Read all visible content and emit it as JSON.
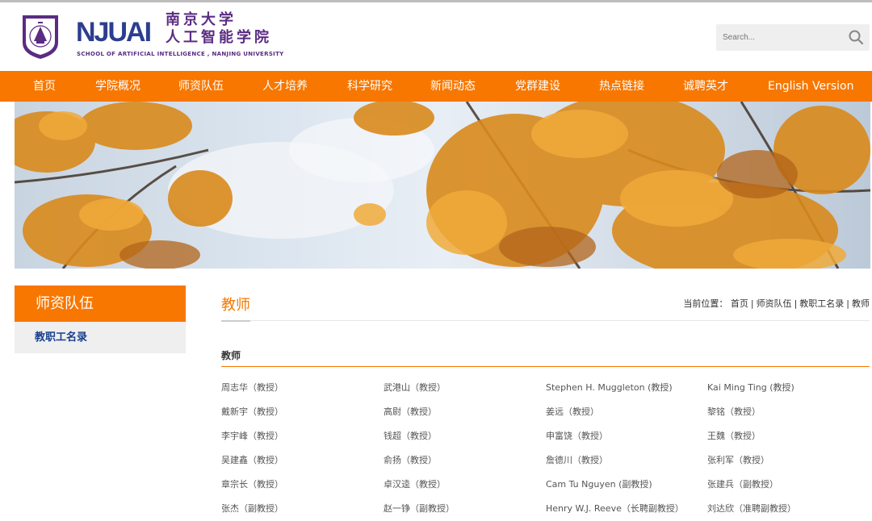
{
  "header": {
    "logo_latin": "NJUAI",
    "logo_cn_line1": "南京大学",
    "logo_cn_line2": "人工智能学院",
    "logo_en": "SCHOOL OF ARTIFICIAL INTELLIGENCE , NANJING UNIVERSITY",
    "search_placeholder": "Search..."
  },
  "nav": [
    {
      "label": "首页"
    },
    {
      "label": "学院概况"
    },
    {
      "label": "师资队伍"
    },
    {
      "label": "人才培养"
    },
    {
      "label": "科学研究"
    },
    {
      "label": "新闻动态"
    },
    {
      "label": "党群建设"
    },
    {
      "label": "热点链接"
    },
    {
      "label": "诚聘英才"
    },
    {
      "label": "English Version"
    }
  ],
  "sidebar": {
    "title": "师资队伍",
    "items": [
      {
        "label": "教职工名录"
      }
    ]
  },
  "main": {
    "title": "教师",
    "breadcrumb_prefix": "当前位置：",
    "breadcrumb": [
      "首页",
      "师资队伍",
      "教职工名录",
      "教师"
    ],
    "section_title": "教师",
    "faculty": [
      [
        "周志华（教授）",
        "武港山（教授）",
        "Stephen H. Muggleton (教授)",
        "Kai Ming Ting (教授)"
      ],
      [
        "戴新宇（教授）",
        "高尉（教授）",
        "姜远（教授）",
        "黎铭（教授）"
      ],
      [
        "李宇峰（教授）",
        "钱超（教授）",
        "申富饶（教授）",
        "王魏（教授）"
      ],
      [
        "吴建鑫（教授）",
        "俞扬（教授）",
        "詹德川（教授）",
        "张利军（教授）"
      ],
      [
        "章宗长（教授）",
        "卓汉逵（教授）",
        "Cam Tu Nguyen (副教授)",
        "张建兵（副教授）"
      ],
      [
        "张杰（副教授）",
        "赵一铮（副教授）",
        "Henry W.J. Reeve（长聘副教授）",
        "刘达欣（准聘副教授）"
      ]
    ]
  },
  "colors": {
    "accent": "#f77700",
    "brand_purple": "#5b2c83",
    "brand_blue": "#2c3e8f",
    "link_blue": "#1a3f8f"
  }
}
